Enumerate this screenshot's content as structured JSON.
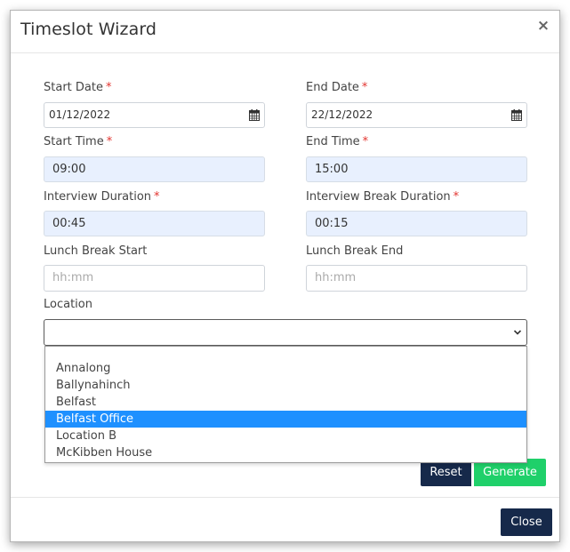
{
  "modal": {
    "title": "Timeslot Wizard",
    "close_glyph": "×"
  },
  "form": {
    "start_date": {
      "label": "Start Date",
      "required_mark": "*",
      "value": "01/12/2022",
      "icon": "calendar-icon"
    },
    "end_date": {
      "label": "End Date",
      "required_mark": "*",
      "value": "22/12/2022",
      "icon": "calendar-icon"
    },
    "start_time": {
      "label": "Start Time",
      "required_mark": "*",
      "value": "09:00"
    },
    "end_time": {
      "label": "End Time",
      "required_mark": "*",
      "value": "15:00"
    },
    "interview_duration": {
      "label": "Interview Duration",
      "required_mark": "*",
      "value": "00:45"
    },
    "interview_break_duration": {
      "label": "Interview Break Duration",
      "required_mark": "*",
      "value": "00:15"
    },
    "lunch_break_start": {
      "label": "Lunch Break Start",
      "value": "",
      "placeholder": "hh:mm"
    },
    "lunch_break_end": {
      "label": "Lunch Break End",
      "value": "",
      "placeholder": "hh:mm"
    },
    "location": {
      "label": "Location",
      "value": "",
      "options": [
        "Annalong",
        "Ballynahinch",
        "Belfast",
        "Belfast Office",
        "Location B",
        "McKibben House"
      ],
      "highlighted_option": "Belfast Office"
    }
  },
  "buttons": {
    "reset": "Reset",
    "generate": "Generate",
    "close": "Close"
  },
  "colors": {
    "navy": "#16294a",
    "green": "#1fd06a",
    "highlight": "#1e90ff",
    "required": "#e3342f",
    "filled_input": "#e8f0fe"
  }
}
